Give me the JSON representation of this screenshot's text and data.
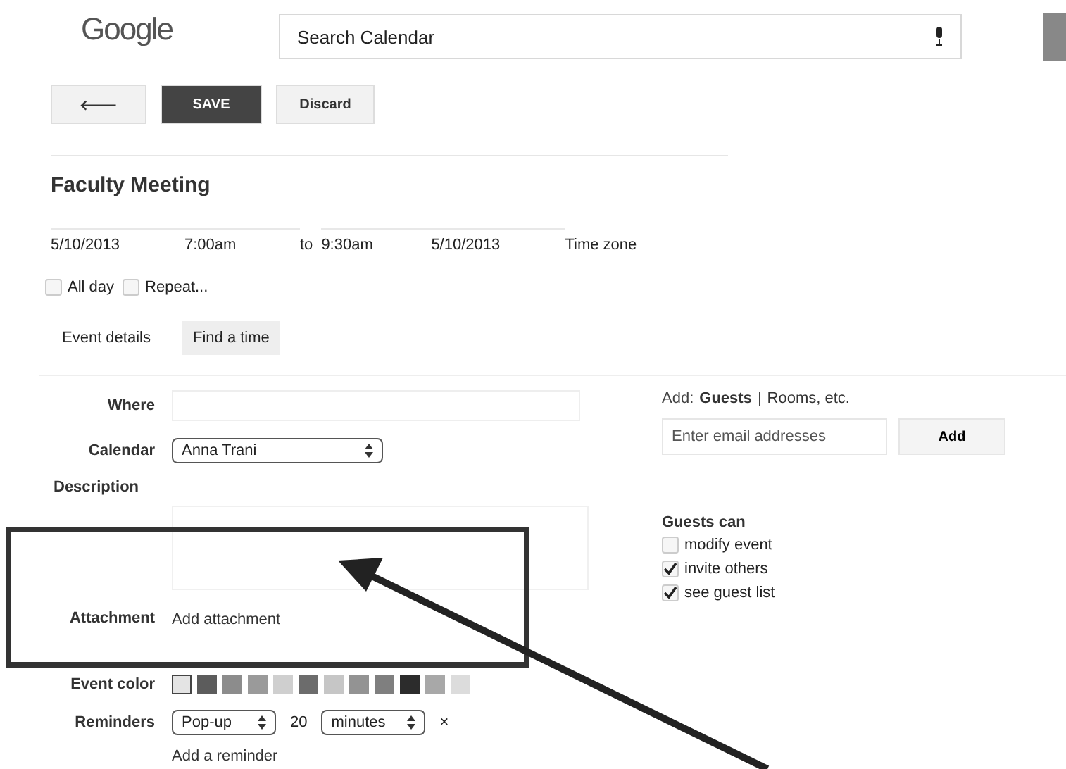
{
  "header": {
    "logo": "Google",
    "search": {
      "placeholder": "Search Calendar"
    }
  },
  "toolbar": {
    "back": "🡐",
    "save": "SAVE",
    "discard": "Discard"
  },
  "event": {
    "title": "Faculty Meeting",
    "start_date": "5/10/2013",
    "start_time": "7:00am",
    "to": "to",
    "end_time": "9:30am",
    "end_date": "5/10/2013",
    "time_zone": "Time zone"
  },
  "options": [
    {
      "label": "All day",
      "checked": false
    },
    {
      "label": "Repeat...",
      "checked": false
    }
  ],
  "tabs": [
    {
      "label": "Event details",
      "selected": true
    },
    {
      "label": "Find a time",
      "selected": false
    }
  ],
  "form": {
    "where_label": "Where",
    "calendar_label": "Calendar",
    "calendar_value": "Anna Trani",
    "description_label": "Description",
    "attachment_label": "Attachment",
    "attachment_link": "Add attachment",
    "color_label": "Event color",
    "reminders_label": "Reminders",
    "reminder_method": "Pop-up",
    "reminder_amount": "20",
    "reminder_unit": "minutes",
    "reminder_remove": "×",
    "add_reminder": "Add a reminder"
  },
  "event_colors": [
    {
      "color": "#e4e4e4",
      "selected": true
    },
    {
      "color": "#5c5c5c",
      "selected": false
    },
    {
      "color": "#8c8c8c",
      "selected": false
    },
    {
      "color": "#9a9a9a",
      "selected": false
    },
    {
      "color": "#cfcfcf",
      "selected": false
    },
    {
      "color": "#6c6c6c",
      "selected": false
    },
    {
      "color": "#c6c6c6",
      "selected": false
    },
    {
      "color": "#939393",
      "selected": false
    },
    {
      "color": "#7f7f7f",
      "selected": false
    },
    {
      "color": "#2c2c2c",
      "selected": false
    },
    {
      "color": "#a8a8a8",
      "selected": false
    },
    {
      "color": "#dcdcdc",
      "selected": false
    }
  ],
  "guests": {
    "add_label": "Add:",
    "guests_link": "Guests",
    "separator": "|",
    "rooms_link": "Rooms, etc.",
    "placeholder": "Enter email addresses",
    "add_button": "Add",
    "can_label": "Guests can",
    "permissions": [
      {
        "label": "modify event",
        "checked": false
      },
      {
        "label": "invite others",
        "checked": true
      },
      {
        "label": "see guest list",
        "checked": true
      }
    ]
  }
}
